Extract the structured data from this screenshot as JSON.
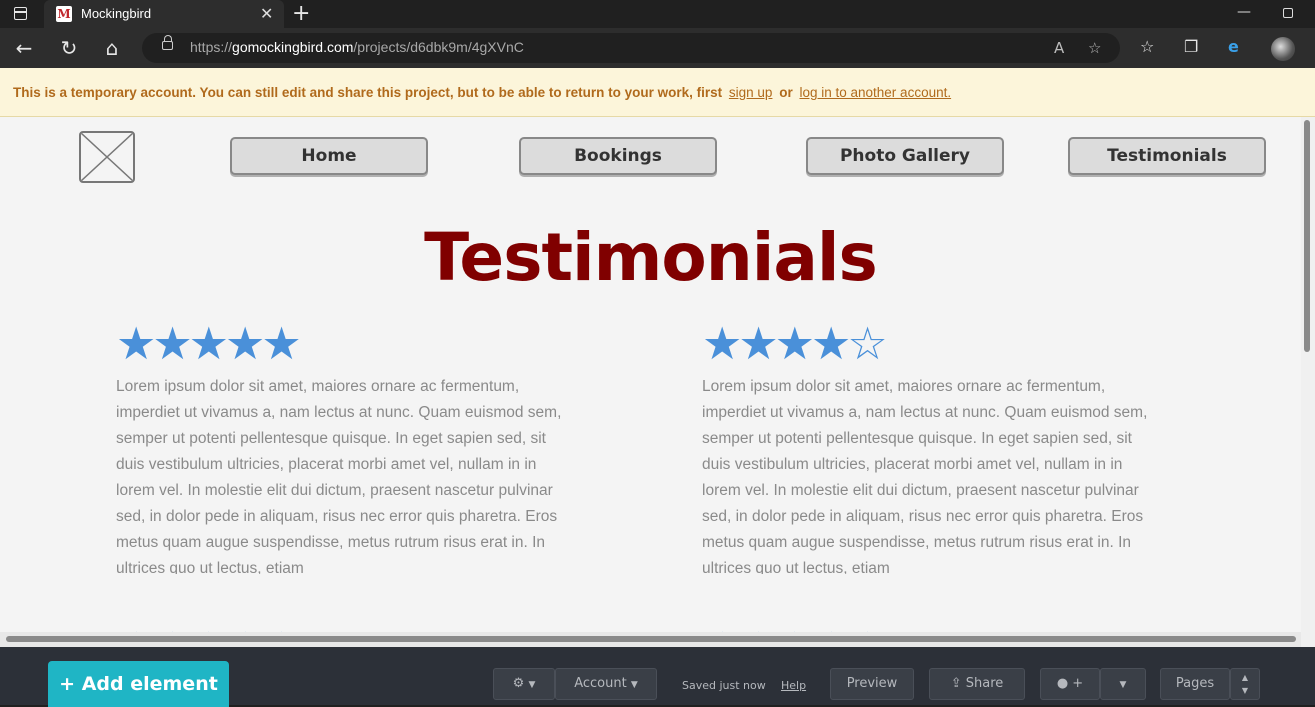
{
  "browser": {
    "tab_title": "Mockingbird",
    "favicon_letter": "M",
    "url_prefix": "https://",
    "url_host": "gomockingbird.com",
    "url_path": "/projects/d6dbk9m/4gXVnC"
  },
  "notice": {
    "text": "This is a temporary account. You can still edit and share this project, but to be able to return to your work, first",
    "signup_label": "sign up",
    "or_label": "or",
    "login_label": "log in to another account."
  },
  "nav": {
    "items": [
      {
        "label": "Home"
      },
      {
        "label": "Bookings"
      },
      {
        "label": "Photo Gallery"
      },
      {
        "label": "Testimonials"
      }
    ]
  },
  "page": {
    "heading": "Testimonials"
  },
  "testimonials": [
    {
      "stars": "★★★★★",
      "rating": 5,
      "text": "Lorem ipsum dolor sit amet, maiores ornare ac fermentum, imperdiet ut vivamus a, nam lectus at nunc. Quam euismod sem, semper ut potenti pellentesque quisque. In eget sapien sed, sit duis vestibulum ultricies, placerat morbi amet vel, nullam in in lorem vel. In molestie elit dui dictum, praesent nascetur pulvinar sed, in dolor pede in aliquam, risus nec error quis pharetra. Eros metus quam augue suspendisse, metus rutrum risus erat in.  In ultrices quo ut lectus, etiam"
    },
    {
      "stars": "★★★★☆",
      "rating": 4,
      "text": "Lorem ipsum dolor sit amet, maiores ornare ac fermentum, imperdiet ut vivamus a, nam lectus at nunc. Quam euismod sem, semper ut potenti pellentesque quisque. In eget sapien sed, sit duis vestibulum ultricies, placerat morbi amet vel, nullam in in lorem vel. In molestie elit dui dictum, praesent nascetur pulvinar sed, in dolor pede in aliquam, risus nec error quis pharetra. Eros metus quam augue suspendisse, metus rutrum risus erat in.  In ultrices quo ut lectus, etiam"
    }
  ],
  "next_row_stars": [
    "★★★★★",
    "★★★★★"
  ],
  "editor": {
    "add_element": "+ Add element",
    "settings_icon": "gear-icon",
    "account_label": "Account",
    "saved_status": "Saved just now",
    "help_label": "Help",
    "preview_label": "Preview",
    "share_label": "Share",
    "pages_label": "Pages"
  },
  "colors": {
    "heading": "#800000",
    "stars": "#4a90d9",
    "add_button": "#1fb5c5",
    "notice_bg": "#fcf5da",
    "notice_text": "#b06a1c"
  }
}
